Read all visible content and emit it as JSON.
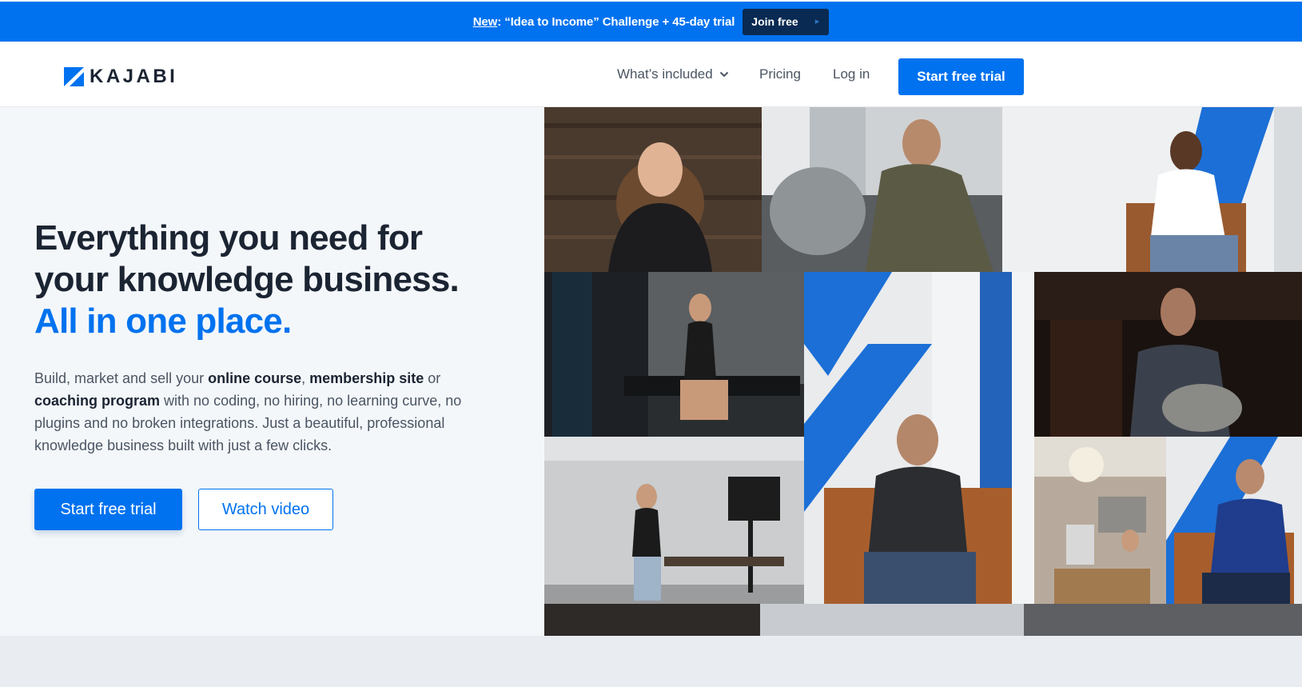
{
  "promo": {
    "new_label": "New",
    "message": ": “Idea to Income” Challenge + 45-day trial",
    "cta": "Join free"
  },
  "header": {
    "logo_text": "KAJABI",
    "nav": {
      "whats_included": "What’s included",
      "pricing": "Pricing",
      "login": "Log in",
      "cta": "Start free trial"
    }
  },
  "hero": {
    "headline_line1": "Everything you need for",
    "headline_line2": "your knowledge business.",
    "headline_accent": "All in one place.",
    "body": {
      "p1": "Build, market and sell your ",
      "b1": "online course",
      "p2": ", ",
      "b2": "membership site",
      "p3": " or ",
      "b3": "coaching program",
      "p4": " with no coding, no hiring, no learning curve, no plugins and no broken integrations. Just a beautiful, professional knowledge business built with just a few clicks."
    },
    "primary_cta": "Start free trial",
    "secondary_cta": "Watch video"
  },
  "colors": {
    "brand_blue": "#0072ef",
    "dark_navy": "#092a52",
    "text_dark": "#1b2432",
    "text_body": "#4a5563",
    "hero_bg": "#f4f7fa"
  },
  "collage": {
    "photos": [
      {
        "name": "photo-woman-smiling"
      },
      {
        "name": "photo-man-motorcycle"
      },
      {
        "name": "photo-man-armchair-gesturing"
      },
      {
        "name": "photo-woman-gym-bench"
      },
      {
        "name": "photo-man-glasses-armchair"
      },
      {
        "name": "photo-man-dark-room"
      },
      {
        "name": "photo-woman-studio-camera"
      },
      {
        "name": "photo-woman-home-office"
      },
      {
        "name": "photo-man-blue-shirt-chair"
      }
    ]
  }
}
